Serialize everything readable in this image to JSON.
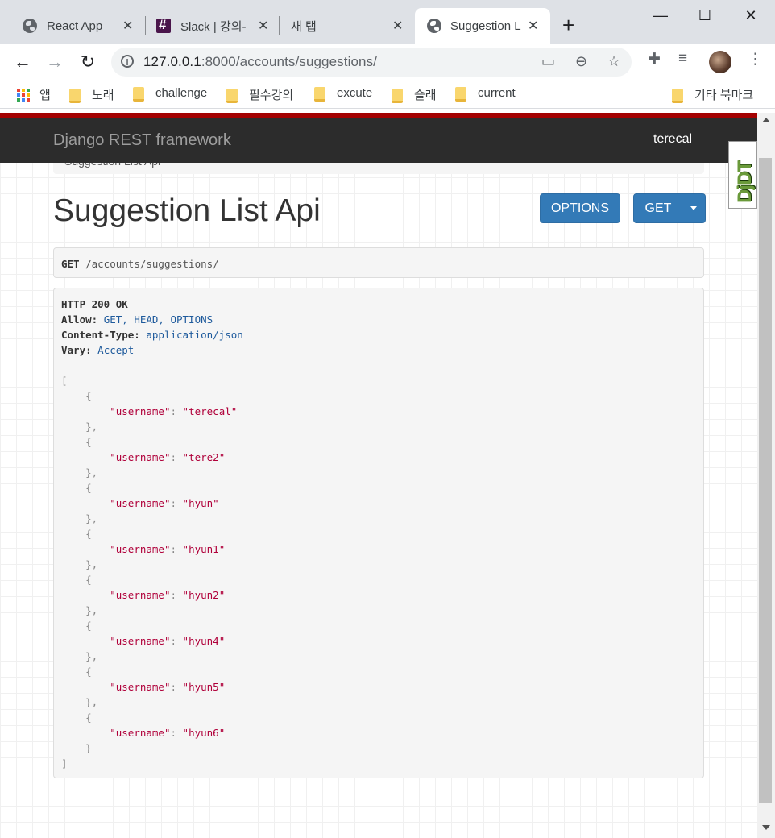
{
  "browser": {
    "tabs": [
      {
        "title": "React App",
        "icon": "globe-icon",
        "active": false
      },
      {
        "title": "Slack | 강의-",
        "icon": "slack-icon",
        "active": false
      },
      {
        "title": "새 탭",
        "icon": "",
        "active": false
      },
      {
        "title": "Suggestion L",
        "icon": "globe-icon",
        "active": true
      }
    ],
    "new_tab": "+",
    "window_controls": {
      "minimize": "—",
      "maximize": "☐",
      "close": "✕"
    },
    "url_host": "127.0.0.1",
    "url_rest": ":8000/accounts/suggestions/",
    "bookmarks": [
      {
        "label": "앱",
        "icon": "apps-icon"
      },
      {
        "label": "노래",
        "icon": "folder-icon"
      },
      {
        "label": "challenge",
        "icon": "folder-icon"
      },
      {
        "label": "필수강의",
        "icon": "folder-icon"
      },
      {
        "label": "excute",
        "icon": "folder-icon"
      },
      {
        "label": "슬래",
        "icon": "folder-icon"
      },
      {
        "label": "current",
        "icon": "folder-icon"
      }
    ],
    "other_bookmarks": "기타 북마크"
  },
  "page": {
    "brand": "Django REST framework",
    "user": "terecal",
    "breadcrumb": "Suggestion List Api",
    "title": "Suggestion List Api",
    "options_button": "OPTIONS",
    "get_button": "GET",
    "request_method": "GET",
    "request_path": "/accounts/suggestions/",
    "response": {
      "status": "HTTP 200 OK",
      "headers": [
        {
          "key": "Allow:",
          "value": "GET, HEAD, OPTIONS"
        },
        {
          "key": "Content-Type:",
          "value": "application/json"
        },
        {
          "key": "Vary:",
          "value": "Accept"
        }
      ],
      "json_key": "\"username\"",
      "usernames": [
        "\"terecal\"",
        "\"tere2\"",
        "\"hyun\"",
        "\"hyun1\"",
        "\"hyun2\"",
        "\"hyun4\"",
        "\"hyun5\"",
        "\"hyun6\""
      ]
    },
    "djdt": "DjDT"
  },
  "colors": {
    "accent": "#337ab7",
    "navbar": "#2c2c2c",
    "danger_bar": "#a30000"
  }
}
